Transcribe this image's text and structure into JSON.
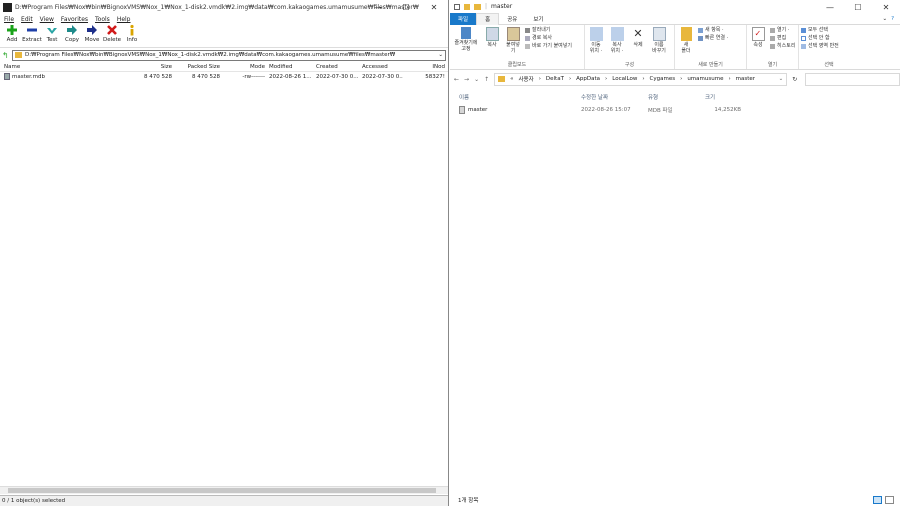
{
  "left": {
    "title": "D:₩Program Files₩Nox₩bin₩BignoxVMS₩Nox_1₩Nox_1-disk2.vmdk₩2.img₩data₩com.kakaogames.umamusume₩files₩master₩",
    "window_controls": {
      "minimize": "—",
      "maximize": "☐",
      "close": "✕"
    },
    "menu": [
      "File",
      "Edit",
      "View",
      "Favorites",
      "Tools",
      "Help"
    ],
    "toolbar": [
      {
        "label": "Add",
        "icon": "add-icon",
        "color": "#1aa31a"
      },
      {
        "label": "Extract",
        "icon": "extract-icon",
        "color": "#1e3fa8"
      },
      {
        "label": "Test",
        "icon": "test-icon",
        "color": "#2aa5a5"
      },
      {
        "label": "Copy",
        "icon": "copy-icon",
        "color": "#1e8a8a"
      },
      {
        "label": "Move",
        "icon": "move-icon",
        "color": "#1e2f8a"
      },
      {
        "label": "Delete",
        "icon": "delete-icon",
        "color": "#d11a1a"
      },
      {
        "label": "Info",
        "icon": "info-icon",
        "color": "#d9a400"
      }
    ],
    "address": "D:₩Program Files₩Nox₩bin₩BignoxVMS₩Nox_1₩Nox_1-disk2.vmdk₩2.img₩data₩com.kakaogames.umamusume₩files₩master₩",
    "columns": [
      "Name",
      "Size",
      "Packed Size",
      "Mode",
      "Modified",
      "Created",
      "Accessed",
      "INod"
    ],
    "rows": [
      [
        "master.mdb",
        "8 470 528",
        "8 470 528",
        "-rw-------",
        "2022-08-26 1...",
        "2022-07-30 0...",
        "2022-07-30 0...",
        "58327!"
      ]
    ],
    "status": "0 / 1 object(s) selected"
  },
  "right": {
    "title": "master",
    "title_sep": "|",
    "window_controls": {
      "minimize": "—",
      "maximize": "☐",
      "close": "✕"
    },
    "tabs": [
      "파일",
      "홈",
      "공유",
      "보기"
    ],
    "ribbon": {
      "clipboard": {
        "pin": "즐겨찾기에\n고정",
        "copy": "복사",
        "paste": "붙여넣기",
        "cut": "잘라내기",
        "copy_path": "경로 복사",
        "paste_shortcut": "바로 가기 붙여넣기",
        "label": "클립보드"
      },
      "organize": {
        "move": "이동\n위치 ·",
        "copy_to": "복사\n위치 ·",
        "delete": "삭제",
        "rename": "이름\n바꾸기",
        "label": "구성"
      },
      "new": {
        "folder": "새\n폴더",
        "new_item": "새 항목 ·",
        "easy_access": "빠른 연결 ·",
        "label": "새로 만들기"
      },
      "open": {
        "properties": "속성",
        "open": "열기 ·",
        "edit": "편집",
        "history": "히스토리",
        "label": "열기"
      },
      "select": {
        "all": "모두 선택",
        "none": "선택 안 함",
        "invert": "선택 영역 반전",
        "label": "선택"
      }
    },
    "path": [
      "사용자",
      "DeltaT",
      "AppData",
      "LocalLow",
      "Cygames",
      "umamusume",
      "master"
    ],
    "path_prefix": "«",
    "nav": {
      "back": "←",
      "forward": "→",
      "recent": "⌄",
      "up": "↑",
      "dropdown": "⌄",
      "refresh": "↻"
    },
    "columns": [
      "이름",
      "수정한 날짜",
      "유형",
      "크기"
    ],
    "rows": [
      [
        "master",
        "2022-08-26 15:07",
        "MDB 파일",
        "14,252KB"
      ]
    ],
    "status": "1개 항목"
  },
  "colors": {
    "accent": "#1979ca",
    "folder": "#e8b73c"
  }
}
